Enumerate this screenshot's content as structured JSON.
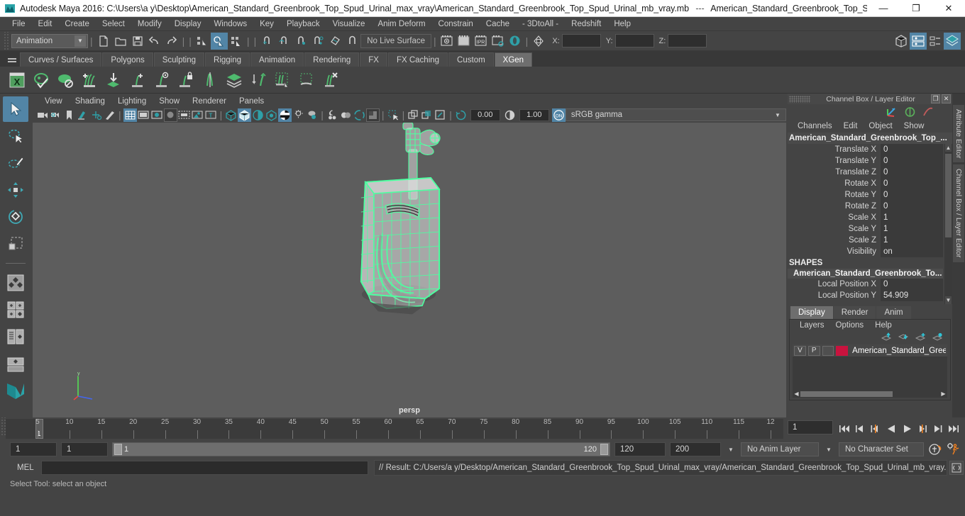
{
  "titlebar": {
    "app_title": "Autodesk Maya 2016: C:\\Users\\a y\\Desktop\\American_Standard_Greenbrook_Top_Spud_Urinal_max_vray\\American_Standard_Greenbrook_Top_Spud_Urinal_mb_vray.mb",
    "separator": "---",
    "doc_title": "American_Standard_Greenbrook_Top_Spud_Urinal_...",
    "minimize": "—",
    "maximize": "❐",
    "close": "✕"
  },
  "menubar": {
    "items": [
      "File",
      "Edit",
      "Create",
      "Select",
      "Modify",
      "Display",
      "Windows",
      "Key",
      "Playback",
      "Visualize",
      "Anim Deform",
      "Constrain",
      "Cache",
      "- 3DtoAll -",
      "Redshift",
      "Help"
    ]
  },
  "statusline": {
    "menu_set": "Animation",
    "no_live_surface": "No Live Surface",
    "coord_x_label": "X:",
    "coord_y_label": "Y:",
    "coord_z_label": "Z:",
    "coord_x_value": "",
    "coord_y_value": "",
    "coord_z_value": "",
    "ipr_label": "IPR"
  },
  "shelf": {
    "tabs": [
      "Curves / Surfaces",
      "Polygons",
      "Sculpting",
      "Rigging",
      "Animation",
      "Rendering",
      "FX",
      "FX Caching",
      "Custom",
      "XGen"
    ],
    "active_tab": "XGen",
    "xgen_letter": "X"
  },
  "viewport": {
    "menu": [
      "View",
      "Shading",
      "Lighting",
      "Show",
      "Renderer",
      "Panels"
    ],
    "exposure_value": "0.00",
    "gamma_value": "1.00",
    "color_profile": "sRGB gamma",
    "view_label": "persp",
    "toggle_on_label": "ON"
  },
  "channelbox": {
    "panel_title": "Channel Box / Layer Editor",
    "menu": [
      "Channels",
      "Edit",
      "Object",
      "Show"
    ],
    "node_name": "American_Standard_Greenbrook_Top_...",
    "attributes": [
      {
        "name": "Translate X",
        "value": "0"
      },
      {
        "name": "Translate Y",
        "value": "0"
      },
      {
        "name": "Translate Z",
        "value": "0"
      },
      {
        "name": "Rotate X",
        "value": "0"
      },
      {
        "name": "Rotate Y",
        "value": "0"
      },
      {
        "name": "Rotate Z",
        "value": "0"
      },
      {
        "name": "Scale X",
        "value": "1"
      },
      {
        "name": "Scale Y",
        "value": "1"
      },
      {
        "name": "Scale Z",
        "value": "1"
      },
      {
        "name": "Visibility",
        "value": "on"
      }
    ],
    "shapes_header": "SHAPES",
    "shape_name": "American_Standard_Greenbrook_To...",
    "shape_attributes": [
      {
        "name": "Local Position X",
        "value": "0"
      },
      {
        "name": "Local Position Y",
        "value": "54.909"
      }
    ]
  },
  "layereditor": {
    "tabs": [
      "Display",
      "Render",
      "Anim"
    ],
    "active_tab": "Display",
    "menu": [
      "Layers",
      "Options",
      "Help"
    ],
    "layer": {
      "visibility": "V",
      "playback": "P",
      "state": "",
      "color": "#c9133e",
      "name": "American_Standard_Gree"
    }
  },
  "right_side_tabs": [
    "Attribute Editor",
    "Channel Box / Layer Editor"
  ],
  "timeline": {
    "tick_labels": [
      "5",
      "10",
      "15",
      "20",
      "25",
      "30",
      "35",
      "40",
      "45",
      "50",
      "55",
      "60",
      "65",
      "70",
      "75",
      "80",
      "85",
      "90",
      "95",
      "100",
      "105",
      "110",
      "115",
      "12"
    ],
    "current_frame_marker": "1",
    "current_frame_field": "1",
    "playback_buttons": [
      "go-to-start",
      "step-back-key",
      "step-back-frame",
      "play-backwards",
      "play-forwards",
      "step-forward-frame",
      "step-forward-key",
      "go-to-end"
    ]
  },
  "rangeslider": {
    "anim_start": "1",
    "range_start": "1",
    "bar_left_value": "1",
    "bar_right_value": "120",
    "range_end": "120",
    "anim_end": "200",
    "anim_layer": "No Anim Layer",
    "character_set": "No Character Set"
  },
  "commandline": {
    "mel_label": "MEL",
    "mel_value": "",
    "result": "// Result: C:/Users/a y/Desktop/American_Standard_Greenbrook_Top_Spud_Urinal_max_vray/American_Standard_Greenbrook_Top_Spud_Urinal_mb_vray.mb"
  },
  "statusbar": {
    "help_text": "Select Tool: select an object"
  },
  "colors": {
    "accent_blue": "#5285a6",
    "teal": "#2fa0a8",
    "wireframe_green": "#4dffa0",
    "layer_red": "#c9133e",
    "viewport_bg": "#5d5d5d",
    "chrome_bg": "#444444"
  }
}
